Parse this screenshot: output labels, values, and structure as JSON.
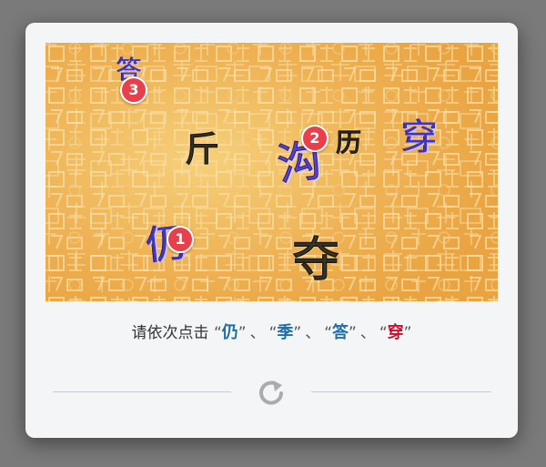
{
  "instruction": {
    "prefix": "请依次点击",
    "targets": [
      {
        "char": "仍",
        "color": "#1d6fa5"
      },
      {
        "char": "季",
        "color": "#1d6fa5"
      },
      {
        "char": "答",
        "color": "#1d6fa5"
      },
      {
        "char": "穿",
        "color": "#c8102e"
      }
    ],
    "separator": "、",
    "open_quote": "“",
    "close_quote": "”"
  },
  "captcha": {
    "background_color": "#eba94a",
    "background_texture": "dense faded chinese character pattern",
    "glyphs": [
      {
        "char": "答",
        "style": "blue"
      },
      {
        "char": "斤",
        "style": "outline"
      },
      {
        "char": "沟",
        "style": "blue-outline"
      },
      {
        "char": "历",
        "style": "outline"
      },
      {
        "char": "穿",
        "style": "blue"
      },
      {
        "char": "仍",
        "style": "blue"
      },
      {
        "char": "夺",
        "style": "outline"
      }
    ],
    "click_markers": [
      {
        "number": "1"
      },
      {
        "number": "2"
      },
      {
        "number": "3"
      }
    ],
    "marker_color": "#e8404a"
  },
  "controls": {
    "refresh_icon": "refresh-icon",
    "refresh_color": "#a9abb0"
  }
}
